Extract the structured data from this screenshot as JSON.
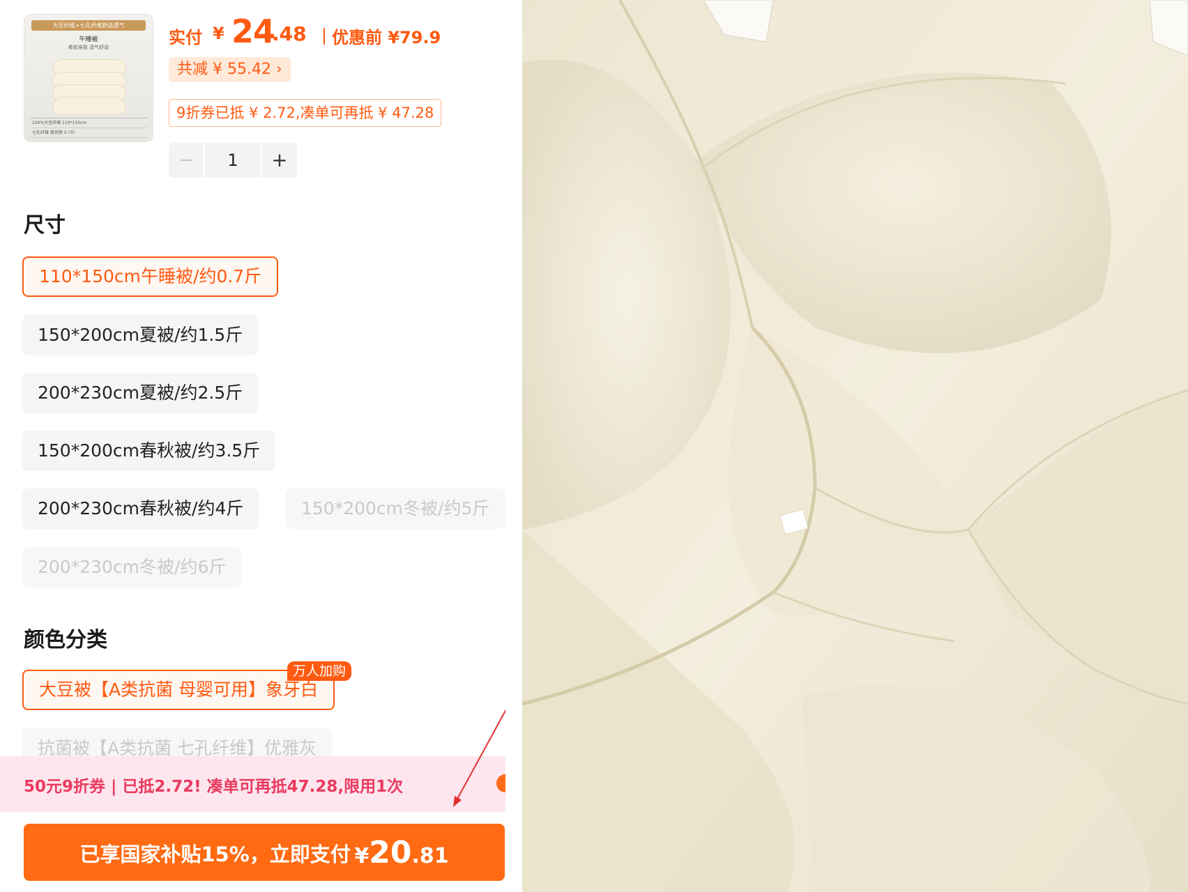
{
  "product": {
    "thumbnail": {
      "band_text": "大豆纤维+七孔纤维舒适透气",
      "name": "午睡被",
      "subtitle": "柔软亲肤 透气舒适",
      "spec_rows": [
        "100%大豆纤维  110*150cm",
        "七孔纤维 填充物 0.7斤"
      ]
    },
    "price": {
      "label": "实付",
      "currency": "¥",
      "integer": "24",
      "decimal": ".48",
      "original": "优惠前 ¥79.9"
    },
    "reduce_pill": "共减 ¥ 55.42 ›",
    "coupon_text": "9折券已抵 ¥ 2.72,凑单可再抵 ¥ 47.28",
    "quantity": {
      "minus": "−",
      "value": "1",
      "plus": "+"
    }
  },
  "size": {
    "title": "尺寸",
    "options": [
      {
        "label": "110*150cm午睡被/约0.7斤",
        "state": "selected"
      },
      {
        "label": "150*200cm夏被/约1.5斤",
        "state": "normal"
      },
      {
        "label": "200*230cm夏被/约2.5斤",
        "state": "normal"
      },
      {
        "label": "150*200cm春秋被/约3.5斤",
        "state": "normal"
      },
      {
        "label": "200*230cm春秋被/约4斤",
        "state": "normal"
      },
      {
        "label": "150*200cm冬被/约5斤",
        "state": "disabled"
      },
      {
        "label": "200*230cm冬被/约6斤",
        "state": "disabled"
      }
    ]
  },
  "color": {
    "title": "颜色分类",
    "options": [
      {
        "label": "大豆被【A类抗菌 母婴可用】象牙白",
        "state": "selected",
        "badge": "万人加购"
      },
      {
        "label": "抗菌被【A类抗菌 七孔纤维】优雅灰",
        "state": "disabled"
      }
    ]
  },
  "promo_bar": {
    "text": "50元9折券 | 已抵2.72! 凑单可再抵47.28,限用1次"
  },
  "pay_button": {
    "prefix": "已享国家补贴15%，立即支付",
    "currency": "¥",
    "integer": "20",
    "decimal": ".81"
  },
  "colors": {
    "accent": "#ff5a11",
    "promo_text": "#ea3a5f",
    "promo_bg": "#fde6ee",
    "quilt": "#f1ebd9"
  },
  "icons": [
    "plus-icon",
    "minus-icon",
    "chevron-right-icon",
    "arrow-annotation-icon"
  ]
}
